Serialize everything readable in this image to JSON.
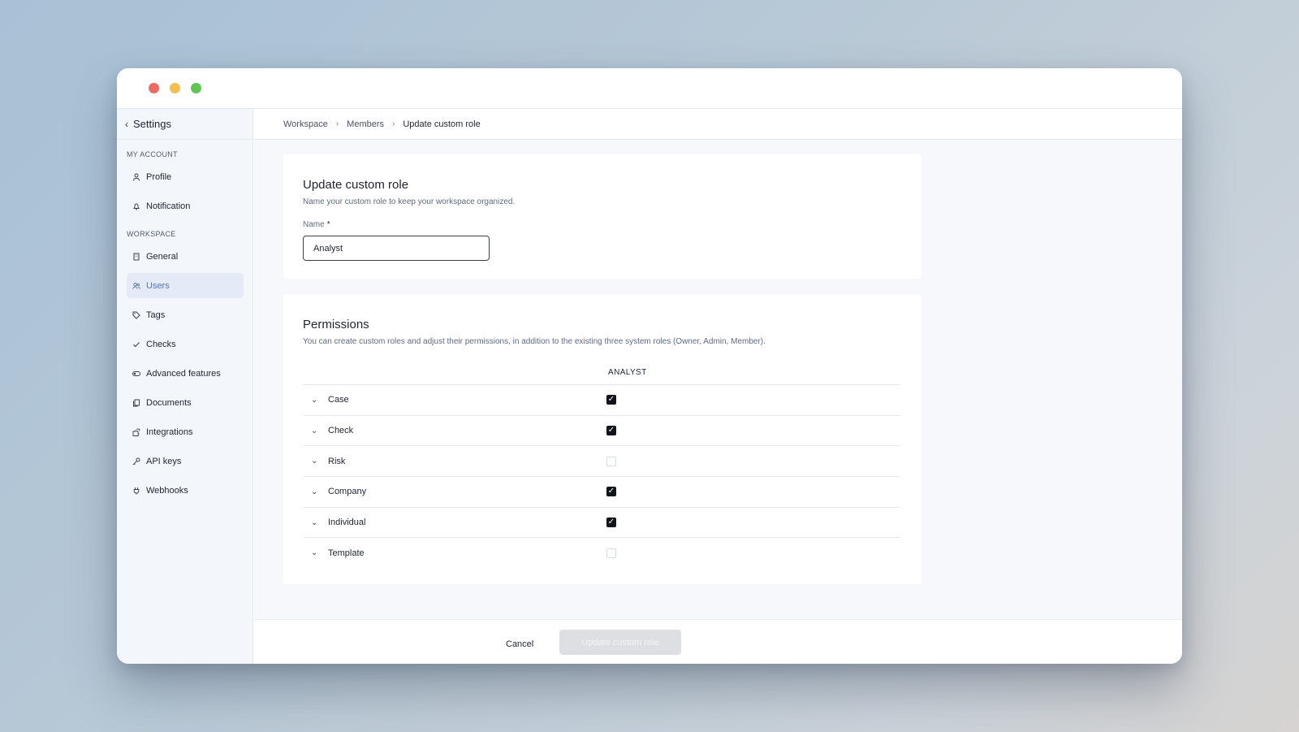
{
  "window": {
    "colors": {
      "close": "#ec6a5e",
      "minimize": "#f4bf4f",
      "maximize": "#61c554"
    }
  },
  "sidebar": {
    "back_label": "Settings",
    "sections": [
      {
        "title": "MY ACCOUNT",
        "items": [
          {
            "label": "Profile",
            "icon": "user-icon"
          },
          {
            "label": "Notification",
            "icon": "bell-icon"
          }
        ]
      },
      {
        "title": "WORKSPACE",
        "items": [
          {
            "label": "General",
            "icon": "building-icon"
          },
          {
            "label": "Users",
            "icon": "users-icon",
            "active": true
          },
          {
            "label": "Tags",
            "icon": "tag-icon"
          },
          {
            "label": "Checks",
            "icon": "check-icon"
          },
          {
            "label": "Advanced features",
            "icon": "toggle-icon"
          },
          {
            "label": "Documents",
            "icon": "documents-icon"
          },
          {
            "label": "Integrations",
            "icon": "puzzle-icon"
          },
          {
            "label": "API keys",
            "icon": "key-icon"
          },
          {
            "label": "Webhooks",
            "icon": "webhook-icon"
          }
        ]
      }
    ]
  },
  "breadcrumb": [
    "Workspace",
    "Members",
    "Update custom role"
  ],
  "role_card": {
    "title": "Update custom role",
    "description": "Name your custom role to keep your workspace organized.",
    "name_label": "Name",
    "required_mark": "*",
    "name_value": "Analyst"
  },
  "permissions": {
    "title": "Permissions",
    "description": "You can create custom roles and adjust their permissions, in addition to the existing three system roles (Owner, Admin, Member).",
    "column_header": "ANALYST",
    "rows": [
      {
        "name": "Case",
        "checked": true
      },
      {
        "name": "Check",
        "checked": true
      },
      {
        "name": "Risk",
        "checked": false
      },
      {
        "name": "Company",
        "checked": true
      },
      {
        "name": "Individual",
        "checked": true
      },
      {
        "name": "Template",
        "checked": false
      }
    ]
  },
  "footer": {
    "cancel_label": "Cancel",
    "submit_label": "Update custom role"
  }
}
